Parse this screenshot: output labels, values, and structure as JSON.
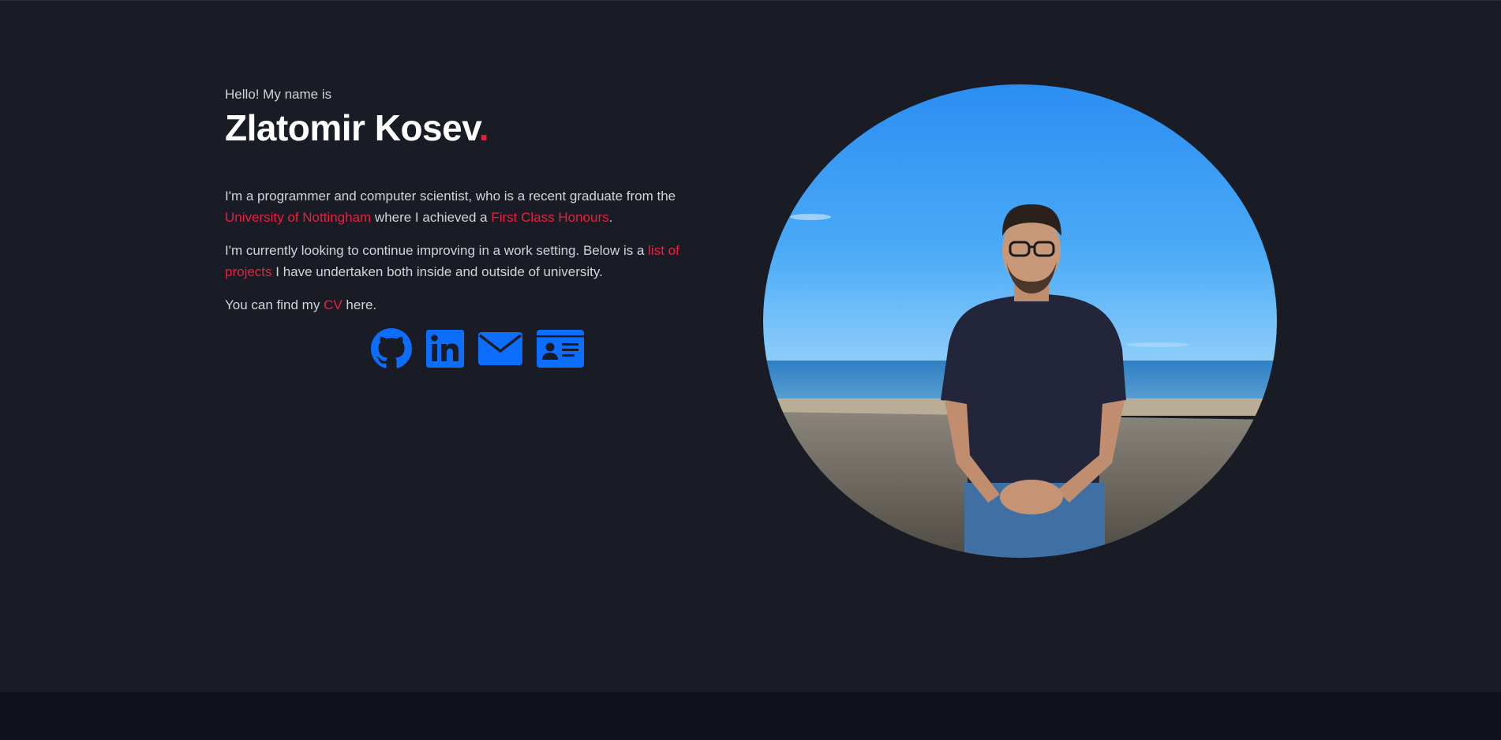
{
  "hero": {
    "greeting": "Hello! My name is",
    "name": "Zlatomir Kosev",
    "name_suffix": "."
  },
  "bio": {
    "p1_text1": "I'm a programmer and computer scientist, who is a recent graduate from the ",
    "p1_link1": "University of Nottingham",
    "p1_text2": " where I achieved a ",
    "p1_link2": "First Class Honours",
    "p1_text3": ".",
    "p2_text1": "I'm currently looking to continue improving in a work setting. Below is a ",
    "p2_link1": "list of projects",
    "p2_text2": " I have undertaken both inside and outside of university.",
    "p3_text1": "You can find my ",
    "p3_link1": "CV",
    "p3_text2": " here."
  },
  "socials": [
    {
      "icon": "github-icon"
    },
    {
      "icon": "linkedin-icon"
    },
    {
      "icon": "email-icon"
    },
    {
      "icon": "contact-card-icon"
    }
  ],
  "colors": {
    "background": "#191b25",
    "footer": "#10111a",
    "accent": "#e8213f",
    "icon": "#0d6efd",
    "heading": "#ffffff",
    "text": "#d3d4d8"
  }
}
